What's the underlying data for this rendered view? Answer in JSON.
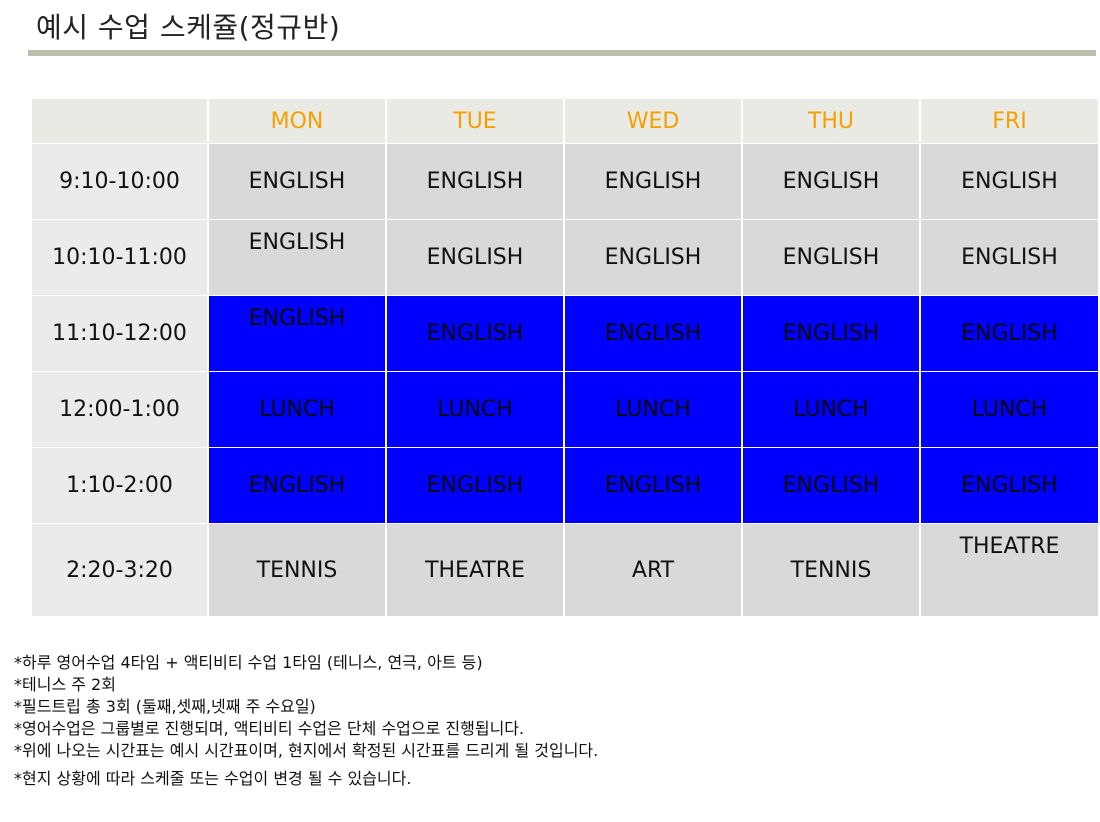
{
  "title": "예시 수업 스케쥴(정규반)",
  "days": [
    "MON",
    "TUE",
    "WED",
    "THU",
    "FRI"
  ],
  "rows": [
    {
      "time": "9:10-10:00",
      "cells": [
        "ENGLISH",
        "ENGLISH",
        "ENGLISH",
        "ENGLISH",
        "ENGLISH"
      ]
    },
    {
      "time": "10:10-11:00",
      "cells": [
        "ENGLISH",
        "ENGLISH",
        "ENGLISH",
        "ENGLISH",
        "ENGLISH"
      ]
    },
    {
      "time": "11:10-12:00",
      "cells": [
        "ENGLISH",
        "ENGLISH",
        "ENGLISH",
        "ENGLISH",
        "ENGLISH"
      ]
    },
    {
      "time": "12:00-1:00",
      "cells": [
        "LUNCH",
        "LUNCH",
        "LUNCH",
        "LUNCH",
        "LUNCH"
      ]
    },
    {
      "time": "1:10-2:00",
      "cells": [
        "ENGLISH",
        "ENGLISH",
        "ENGLISH",
        "ENGLISH",
        "ENGLISH"
      ]
    },
    {
      "time": "2:20-3:20",
      "cells": [
        "TENNIS",
        "THEATRE",
        "ART",
        "TENNIS",
        "THEATRE"
      ]
    }
  ],
  "colors": {
    "header_bg": "#e9eae4",
    "day_text": "#f5a000",
    "gray_cell": "#d9d9d9",
    "blue_cell": "#0000ff",
    "tennis": "#ff0000",
    "theatre": "#0000ff",
    "art": "#7030a0"
  },
  "notes": [
    "*하루 영어수업 4타임 + 액티비티 수업 1타임 (테니스, 연극, 아트 등)",
    "*테니스 주 2회",
    "*필드트립 총 3회 (둘째,셋째,넷째 주 수요일)",
    "*영어수업은 그룹별로 진행되며, 액티비티 수업은 단체 수업으로 진행됩니다.",
    "*위에 나오는 시간표는 예시 시간표이며, 현지에서 확정된 시간표를 드리게 될 것입니다.",
    "*현지 상황에 따라 스케줄 또는 수업이 변경 될 수 있습니다."
  ]
}
